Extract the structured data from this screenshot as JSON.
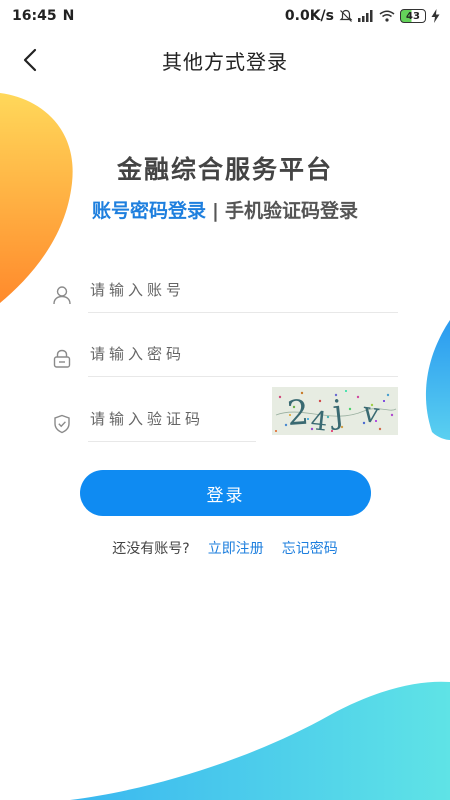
{
  "status_bar": {
    "time": "16:45",
    "notification_icon": "n-app-icon",
    "network_speed": "0.0K/s",
    "battery_level": "43",
    "icons": [
      "mute-bell-icon",
      "signal-icon",
      "wifi-icon",
      "battery-icon",
      "charging-icon"
    ]
  },
  "header": {
    "back_icon": "chevron-left-icon",
    "title": "其他方式登录"
  },
  "app": {
    "title": "金融综合服务平台"
  },
  "login_tabs": {
    "active": "账号密码登录",
    "separator": "|",
    "inactive": "手机验证码登录"
  },
  "form": {
    "account": {
      "icon": "user-icon",
      "placeholder": "请输入账号",
      "value": ""
    },
    "password": {
      "icon": "lock-icon",
      "placeholder": "请输入密码",
      "value": ""
    },
    "captcha": {
      "icon": "shield-icon",
      "placeholder": "请输入验证码",
      "value": "",
      "image_text": "24jv"
    }
  },
  "login_button": "登录",
  "bottom": {
    "no_account_text": "还没有账号?",
    "register_link": "立即注册",
    "forgot_link": "忘记密码"
  },
  "colors": {
    "accent": "#1e7fde",
    "button": "#0f8bf2",
    "blob_orange": "#ff9a3c",
    "blob_yellow": "#ffd24a",
    "blob_blue": "#27a7ec",
    "blob_cyan": "#5fe3e6"
  }
}
